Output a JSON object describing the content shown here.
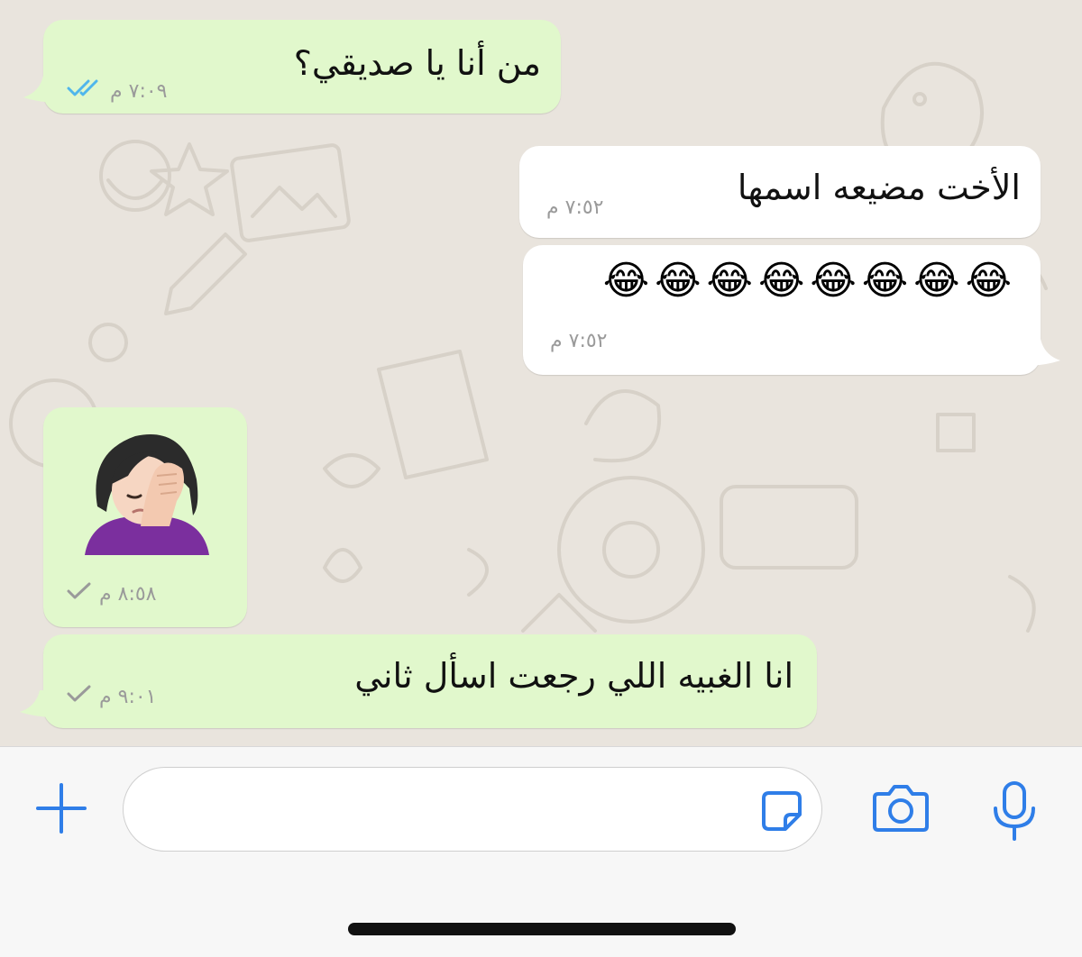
{
  "colors": {
    "outgoing_bubble": "#e1f8cc",
    "incoming_bubble": "#ffffff",
    "chat_background": "#e9e4dd",
    "read_tick": "#4fb6ec",
    "sent_tick": "#9a9a9a",
    "accent": "#2f7ee8"
  },
  "messages": [
    {
      "direction": "outgoing",
      "text": "من أنا يا صديقي؟",
      "time": "٧:٠٩ م",
      "status": "read",
      "status_icon": "double-check-icon"
    },
    {
      "direction": "incoming",
      "text": "الأخت مضيعه اسمها",
      "time": "٧:٥٢ م"
    },
    {
      "direction": "incoming",
      "text": "😂😂😂😂😂😂😂😂",
      "time": "٧:٥٢ م"
    },
    {
      "direction": "outgoing",
      "text": "🤦🏻‍♀️",
      "time": "٨:٥٨ م",
      "status": "sent",
      "status_icon": "single-check-icon"
    },
    {
      "direction": "outgoing",
      "text": "انا الغبيه اللي رجعت اسأل ثاني",
      "time": "٩:٠١ م",
      "status": "sent",
      "status_icon": "single-check-icon"
    }
  ],
  "input_bar": {
    "attach_icon": "plus-icon",
    "message_placeholder": "",
    "sticker_icon": "sticker-icon",
    "camera_icon": "camera-icon",
    "mic_icon": "microphone-icon"
  }
}
